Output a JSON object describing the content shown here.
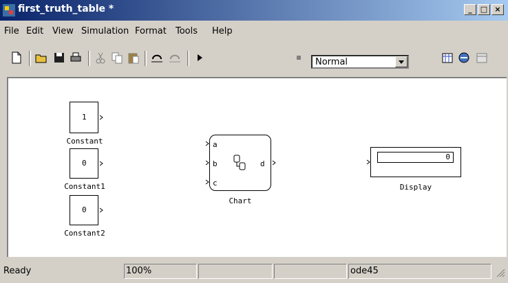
{
  "window": {
    "title": "first_truth_table *"
  },
  "menu": [
    "File",
    "Edit",
    "View",
    "Simulation",
    "Format",
    "Tools",
    "Help"
  ],
  "toolbar": {
    "icons": [
      "new-file-icon",
      "open-folder-icon",
      "save-icon",
      "print-icon",
      "cut-icon",
      "copy-icon",
      "paste-icon",
      "undo-icon",
      "redo-icon",
      "play-icon",
      "stop-icon",
      "library-browser-icon",
      "model-explorer-icon",
      "debug-icon"
    ],
    "sim_mode": "Normal"
  },
  "model": {
    "constants": [
      {
        "name": "Constant",
        "value": "1"
      },
      {
        "name": "Constant1",
        "value": "0"
      },
      {
        "name": "Constant2",
        "value": "0"
      }
    ],
    "chart": {
      "name": "Chart",
      "inputs": [
        "a",
        "b",
        "c"
      ],
      "output": "d"
    },
    "display": {
      "name": "Display",
      "value": "0"
    }
  },
  "status": {
    "state": "Ready",
    "zoom": "100%",
    "solver": "ode45"
  },
  "colors": {
    "titlebar_start": "#0a246a",
    "titlebar_end": "#a6caf0",
    "chrome": "#d4d0c8"
  }
}
